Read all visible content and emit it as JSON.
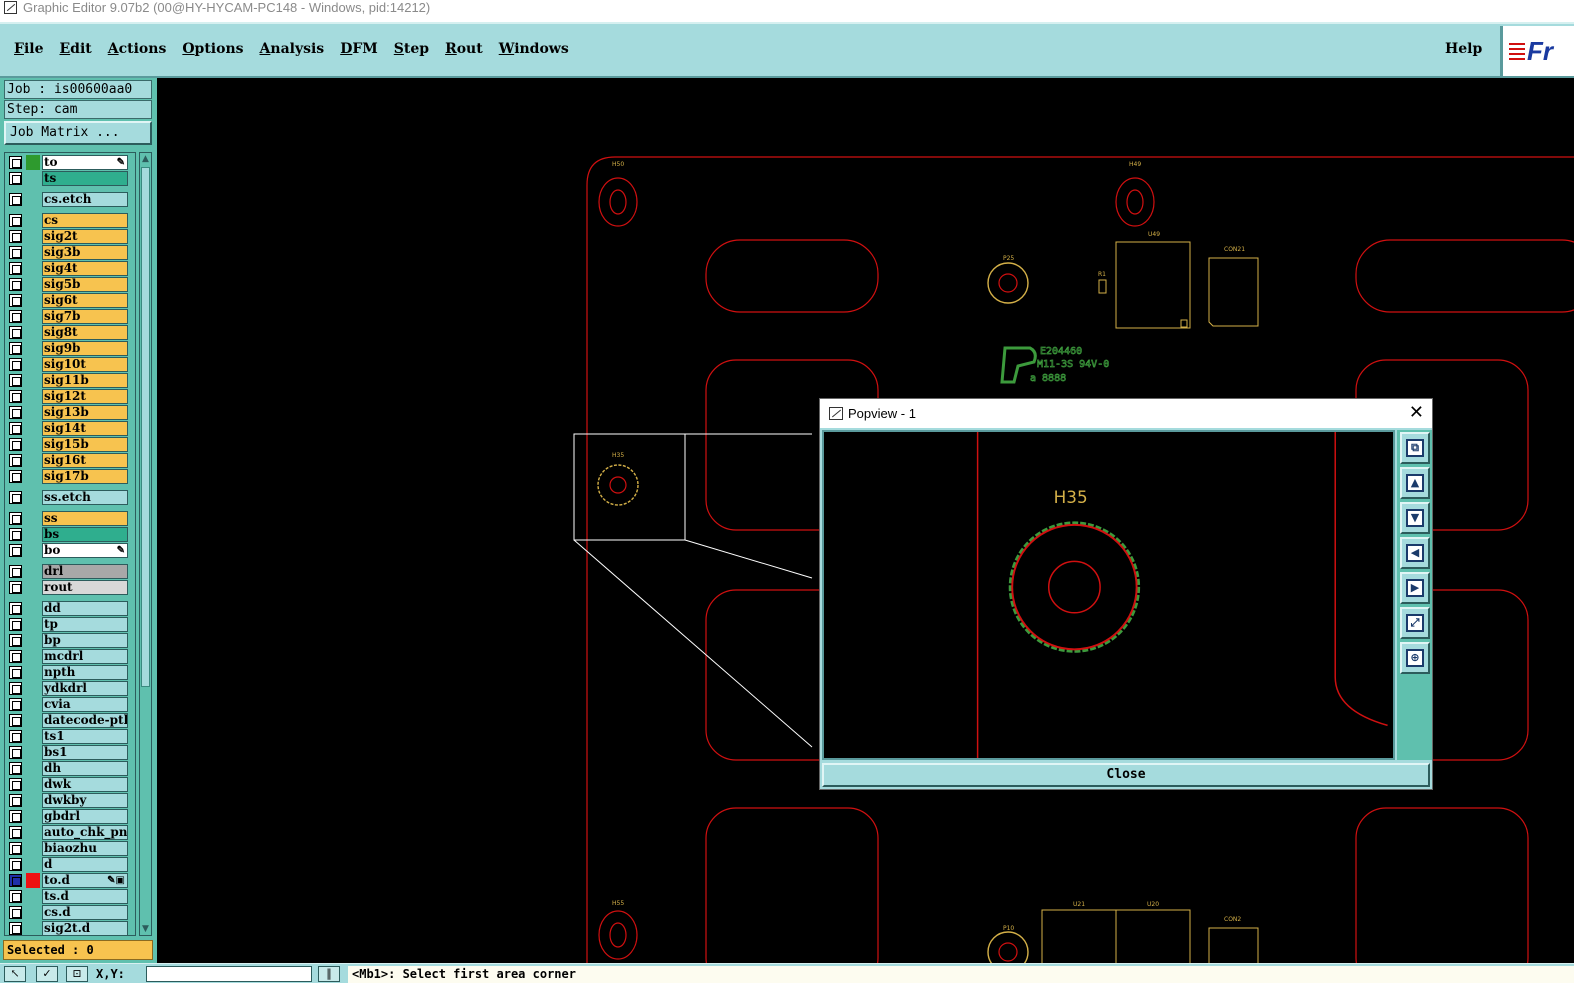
{
  "window": {
    "title": "Graphic Editor 9.07b2 (00@HY-HYCAM-PC148 - Windows, pid:14212)"
  },
  "menubar": {
    "items": [
      {
        "first": "F",
        "rest": "ile"
      },
      {
        "first": "E",
        "rest": "dit"
      },
      {
        "first": "A",
        "rest": "ctions"
      },
      {
        "first": "O",
        "rest": "ptions"
      },
      {
        "first": "A",
        "rest": "nalysis"
      },
      {
        "first": "D",
        "rest": "FM"
      },
      {
        "first": "S",
        "rest": "tep"
      },
      {
        "first": "R",
        "rest": "out"
      },
      {
        "first": "W",
        "rest": "indows"
      }
    ],
    "help": "Help",
    "logo_text": "Fr"
  },
  "sidebar": {
    "job": "Job : is00600aa0",
    "step": "Step: cam",
    "job_matrix": "Job Matrix ...",
    "selected": "Selected : 0",
    "layers": [
      {
        "name": "to",
        "bg": "#ffffff",
        "mark": "#2e9a2e",
        "flag": "✎",
        "group": 0
      },
      {
        "name": "ts",
        "bg": "#2fae8e",
        "mark": "",
        "flag": "",
        "group": 0
      },
      {
        "name": "cs.etch",
        "bg": "#a5dbdd",
        "mark": "",
        "flag": "",
        "group": 1
      },
      {
        "name": "cs",
        "bg": "#f7c34f",
        "mark": "",
        "flag": "",
        "group": 2
      },
      {
        "name": "sig2t",
        "bg": "#f7c34f",
        "mark": "",
        "flag": "",
        "group": 2
      },
      {
        "name": "sig3b",
        "bg": "#f7c34f",
        "mark": "",
        "flag": "",
        "group": 2
      },
      {
        "name": "sig4t",
        "bg": "#f7c34f",
        "mark": "",
        "flag": "",
        "group": 2
      },
      {
        "name": "sig5b",
        "bg": "#f7c34f",
        "mark": "",
        "flag": "",
        "group": 2
      },
      {
        "name": "sig6t",
        "bg": "#f7c34f",
        "mark": "",
        "flag": "",
        "group": 2
      },
      {
        "name": "sig7b",
        "bg": "#f7c34f",
        "mark": "",
        "flag": "",
        "group": 2
      },
      {
        "name": "sig8t",
        "bg": "#f7c34f",
        "mark": "",
        "flag": "",
        "group": 2
      },
      {
        "name": "sig9b",
        "bg": "#f7c34f",
        "mark": "",
        "flag": "",
        "group": 2
      },
      {
        "name": "sig10t",
        "bg": "#f7c34f",
        "mark": "",
        "flag": "",
        "group": 2
      },
      {
        "name": "sig11b",
        "bg": "#f7c34f",
        "mark": "",
        "flag": "",
        "group": 2
      },
      {
        "name": "sig12t",
        "bg": "#f7c34f",
        "mark": "",
        "flag": "",
        "group": 2
      },
      {
        "name": "sig13b",
        "bg": "#f7c34f",
        "mark": "",
        "flag": "",
        "group": 2
      },
      {
        "name": "sig14t",
        "bg": "#f7c34f",
        "mark": "",
        "flag": "",
        "group": 2
      },
      {
        "name": "sig15b",
        "bg": "#f7c34f",
        "mark": "",
        "flag": "",
        "group": 2
      },
      {
        "name": "sig16t",
        "bg": "#f7c34f",
        "mark": "",
        "flag": "",
        "group": 2
      },
      {
        "name": "sig17b",
        "bg": "#f7c34f",
        "mark": "",
        "flag": "",
        "group": 2
      },
      {
        "name": "ss.etch",
        "bg": "#a5dbdd",
        "mark": "",
        "flag": "",
        "group": 3
      },
      {
        "name": "ss",
        "bg": "#f7c34f",
        "mark": "",
        "flag": "",
        "group": 4
      },
      {
        "name": "bs",
        "bg": "#2fae8e",
        "mark": "",
        "flag": "",
        "group": 4
      },
      {
        "name": "bo",
        "bg": "#ffffff",
        "mark": "",
        "flag": "✎",
        "group": 4
      },
      {
        "name": "drl",
        "bg": "#a8a8a8",
        "mark": "",
        "flag": "",
        "group": 5
      },
      {
        "name": "rout",
        "bg": "#d8d8d8",
        "mark": "",
        "flag": "",
        "group": 5
      },
      {
        "name": "dd",
        "bg": "#a5dbdd",
        "mark": "",
        "flag": "",
        "group": 6
      },
      {
        "name": "tp",
        "bg": "#a5dbdd",
        "mark": "",
        "flag": "",
        "group": 6
      },
      {
        "name": "bp",
        "bg": "#a5dbdd",
        "mark": "",
        "flag": "",
        "group": 6
      },
      {
        "name": "mcdrl",
        "bg": "#a5dbdd",
        "mark": "",
        "flag": "",
        "group": 6
      },
      {
        "name": "npth",
        "bg": "#a5dbdd",
        "mark": "",
        "flag": "",
        "group": 6
      },
      {
        "name": "ydkdrl",
        "bg": "#a5dbdd",
        "mark": "",
        "flag": "",
        "group": 6
      },
      {
        "name": "cvia",
        "bg": "#a5dbdd",
        "mark": "",
        "flag": "",
        "group": 6
      },
      {
        "name": "datecode-pth",
        "bg": "#a5dbdd",
        "mark": "",
        "flag": "",
        "group": 6
      },
      {
        "name": "ts1",
        "bg": "#a5dbdd",
        "mark": "",
        "flag": "",
        "group": 6
      },
      {
        "name": "bs1",
        "bg": "#a5dbdd",
        "mark": "",
        "flag": "",
        "group": 6
      },
      {
        "name": "dh",
        "bg": "#a5dbdd",
        "mark": "",
        "flag": "",
        "group": 6
      },
      {
        "name": "dwk",
        "bg": "#a5dbdd",
        "mark": "",
        "flag": "",
        "group": 6
      },
      {
        "name": "dwkby",
        "bg": "#a5dbdd",
        "mark": "",
        "flag": "",
        "group": 6
      },
      {
        "name": "gbdrl",
        "bg": "#a5dbdd",
        "mark": "",
        "flag": "",
        "group": 6
      },
      {
        "name": "auto_chk_pnl",
        "bg": "#a5dbdd",
        "mark": "",
        "flag": "",
        "group": 6
      },
      {
        "name": "biaozhu",
        "bg": "#a5dbdd",
        "mark": "",
        "flag": "",
        "group": 6
      },
      {
        "name": "d",
        "bg": "#a5dbdd",
        "mark": "",
        "flag": "",
        "group": 6
      },
      {
        "name": "to.d",
        "bg": "#a5dbdd",
        "mark": "#ee1111",
        "flag": "✎▣",
        "group": 6,
        "active": true
      },
      {
        "name": "ts.d",
        "bg": "#a5dbdd",
        "mark": "",
        "flag": "",
        "group": 6
      },
      {
        "name": "cs.d",
        "bg": "#a5dbdd",
        "mark": "",
        "flag": "",
        "group": 6
      },
      {
        "name": "sig2t.d",
        "bg": "#a5dbdd",
        "mark": "",
        "flag": "",
        "group": 6
      }
    ]
  },
  "canvas": {
    "hole_labels": [
      "H50",
      "H49",
      "H35",
      "H55"
    ],
    "comp_labels": [
      "P25",
      "R1",
      "U49",
      "CON21",
      "P10",
      "U21",
      "U20",
      "CON2"
    ],
    "ul_line1": "E204460",
    "ul_line2": "M11-3S 94V-0",
    "ul_line3": "a 8888"
  },
  "popview": {
    "title": "Popview - 1",
    "label": "H35",
    "close": "Close",
    "tools": [
      "zoom-window-icon",
      "pan-up-icon",
      "pan-down-icon",
      "pan-left-icon",
      "pan-right-icon",
      "fit-all-icon",
      "zoom-center-icon"
    ]
  },
  "statusbar": {
    "xy_label": "X,Y:",
    "message": "<Mb1>: Select first area corner"
  },
  "colors": {
    "panel": "#a5dbdd",
    "panel_dark": "#5fc0ae",
    "outline": "#d01010",
    "silk": "#d4b048",
    "green": "#3c9a3c"
  }
}
